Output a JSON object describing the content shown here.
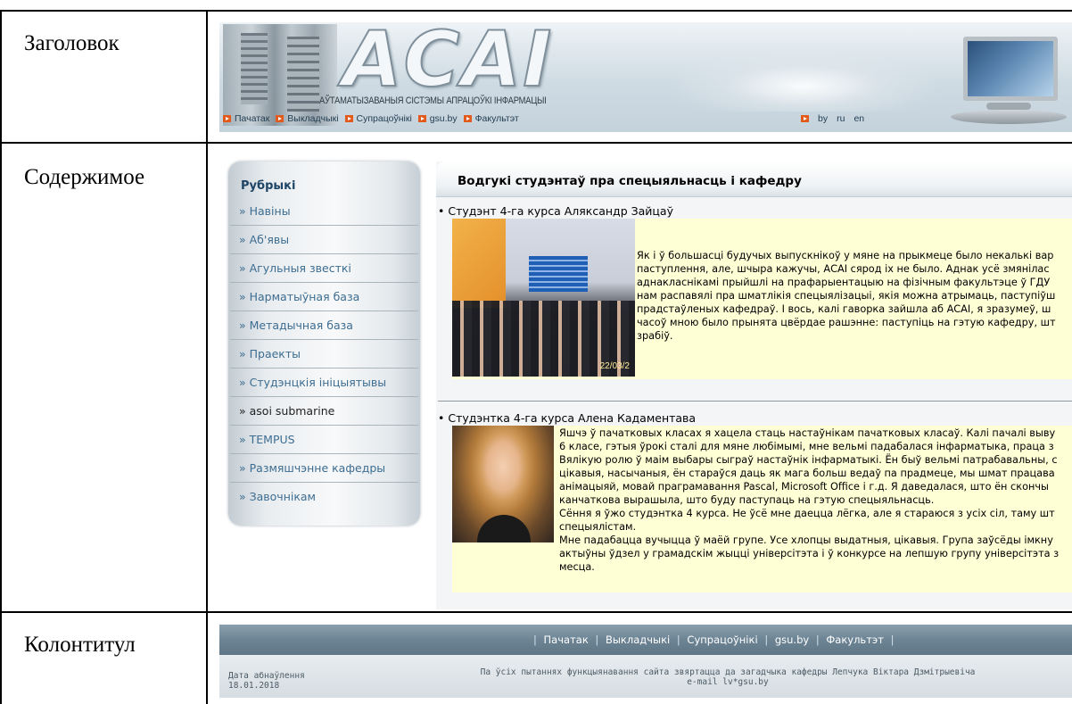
{
  "table": {
    "row_labels": [
      "Заголовок",
      "Содержимое",
      "Колонтитул"
    ]
  },
  "header": {
    "logo": "АСАІ",
    "subtitle": "АЎТАМАТЫЗАВАНЫЯ СІСТЭМЫ АПРАЦОЎКІ ІНФАРМАЦЫІ",
    "nav": [
      "Пачатак",
      "Выкладчыкі",
      "Супрацоўнікі",
      "gsu.by",
      "Факультэт"
    ],
    "lang": [
      "by",
      "ru",
      "en"
    ],
    "bullet_color": "#e25a1b"
  },
  "sidebar": {
    "title": "Рубрыкі",
    "items": [
      "» Навіны",
      "» Аб'явы",
      "» Агульныя звесткі",
      "» Нарматыўная база",
      "» Метадычная база",
      "» Праекты",
      "» Студэнцкія ініцыятывы",
      "» asoi submarine",
      "» TEMPUS",
      "» Размяшчэнне кафедры",
      "» Завочнікам"
    ]
  },
  "main": {
    "heading": "Водгукі студэнтаў пра спецыяльнасць і кафедру",
    "posts": [
      {
        "author": "• Студэнт 4-га курса Аляксандр Зайцаў",
        "photo_stamp": "22/03/2",
        "lines": [
          "Як і ў большасці будучых выпускнікоў у мяне на прыкмеце было некалькі вар",
          "паступлення, але, шчыра кажучы, АСАІ сярод іх не было. Аднак усё змянілас",
          "аднакласнікамі прыйшлі на прафарыентацыю на фізічным факультэце ў ГДУ",
          "нам распавялі пра шматлікія спецыялізацыі, якія можна атрымаць, паступіўш",
          "прадстаўленых кафедраў. І вось, калі гаворка зайшла аб АСАІ, я зразумеў, ш",
          "часоў мною было прынята цвёрдае рашэнне: паступіць на гэтую кафедру, шт",
          "зрабіў."
        ]
      },
      {
        "author": "• Студэнтка 4-га курса Алена Кадаментава",
        "lines": [
          "Яшчэ ў пачатковых класах я хацела стаць настаўнікам пачатковых класаў. Калі пачалі выву",
          "6 класе, гэтыя ўрокі сталі для мяне любімымі, мне вельмі падабалася інфарматыка, праца з",
          "Вялікую ролю ў маім выбары сыграў настаўнік інфарматыкі. Ён быў вельмі патрабавальны, с",
          "цікавыя, насычаныя, ён стараўся даць як мага больш ведаў па прадмеце, мы шмат працава",
          "анімацыяй, мовай праграмавання Pascal, Microsoft Office і г.д. Я даведалася, што ён скончы",
          "канчаткова вырашыла, што буду паступаць на гэтую спецыяльнасць.",
          "Сёння я ўжо студэнтка 4 курса. Не ўсё мне даецца лёгка, але я стараюся з усіх сіл, таму шт",
          "спецыялістам.",
          "Мне падабацца вучыцца ў маёй групе. Усе хлопцы выдатныя, цікавыя. Група заўсёды імкну",
          "актыўны ўдзел у грамадскім жыцці універсітэта і ў конкурсе на лепшую групу універсітэта з",
          "месца."
        ]
      }
    ],
    "highlight_color": "#ffffd6"
  },
  "footer": {
    "nav": [
      "Пачатак",
      "Выкладчыкі",
      "Супрацоўнікі",
      "gsu.by",
      "Факультэт"
    ],
    "updated_label": "Дата абнаўлення",
    "updated_date": "18.01.2018",
    "contact_line1": "Па ўсіх пытаннях функцыянавання сайта звяртацца да загадчыка кафедры Лепчука Віктара Дзмітрыевіча",
    "contact_line2": "e-mail lv*gsu.by"
  }
}
